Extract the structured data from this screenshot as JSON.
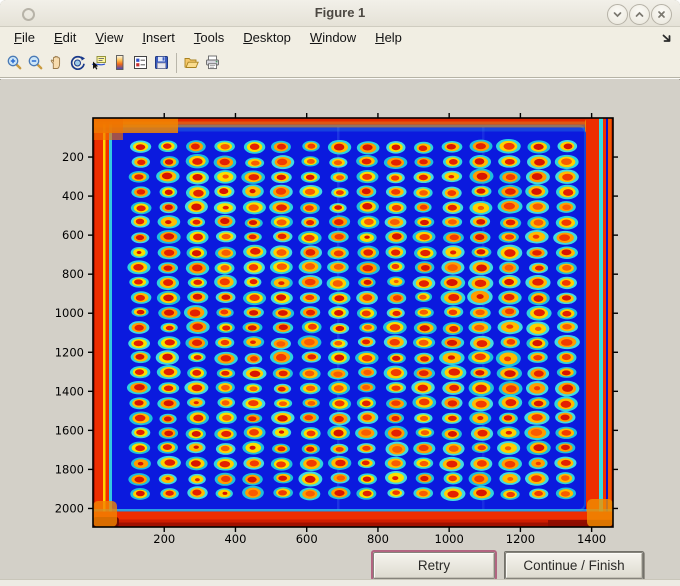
{
  "window": {
    "title": "Figure 1",
    "controls": [
      "shade-window",
      "unshade-window",
      "close-window"
    ]
  },
  "menubar": {
    "items": [
      {
        "label": "File",
        "mnemonic": "F",
        "rest": "ile"
      },
      {
        "label": "Edit",
        "mnemonic": "E",
        "rest": "dit"
      },
      {
        "label": "View",
        "mnemonic": "V",
        "rest": "iew"
      },
      {
        "label": "Insert",
        "mnemonic": "I",
        "rest": "nsert"
      },
      {
        "label": "Tools",
        "mnemonic": "T",
        "rest": "ools"
      },
      {
        "label": "Desktop",
        "mnemonic": "D",
        "rest": "esktop"
      },
      {
        "label": "Window",
        "mnemonic": "W",
        "rest": "indow"
      },
      {
        "label": "Help",
        "mnemonic": "H",
        "rest": "elp"
      }
    ]
  },
  "toolbar": {
    "buttons": [
      "zoom-in",
      "zoom-out",
      "pan",
      "rotate-3d",
      "data-cursor",
      "insert-colorbar",
      "insert-legend",
      "save-figure",
      "open-file",
      "print-figure"
    ]
  },
  "actions": {
    "retry_label": "Retry",
    "continue_label": "Continue / Finish"
  },
  "chart_data": {
    "type": "heatmap",
    "title": "",
    "xlabel": "",
    "ylabel": "",
    "x_range": [
      0,
      1460
    ],
    "y_range": [
      0,
      2095
    ],
    "x_ticks": [
      200,
      400,
      600,
      800,
      1000,
      1200,
      1400
    ],
    "y_ticks": [
      200,
      400,
      600,
      800,
      1000,
      1200,
      1400,
      1600,
      1800,
      2000
    ],
    "y_axis_direction": "image coordinates, origin top-left, y increases downward",
    "grid_on": false,
    "legend": "none",
    "description": "Jet-colormap pseudocolor scan of a 384-spot plate: 24 rows x 16 columns of spots with red-hot centers, yellow/orange rings and cyan halos on a deep blue background; saturated red/orange bands along all four plate edges with yellow and cyan streaks and orange corner blobs",
    "grid": {
      "rows": 24,
      "cols": 16,
      "first_col_center_x": 132,
      "col_pitch_x": 79.8,
      "first_row_center_y": 148,
      "row_pitch_y": 77.2
    },
    "colors": {
      "background_blue": "#0912d2",
      "plate_blue": "#0b1ade",
      "edge_red": "#ee2e00",
      "edge_dark_red": "#b81800",
      "edge_orange": "#f28500",
      "edge_yellow_streak": "#ffd400",
      "edge_cyan_streak": "#38dce2",
      "spot_centers": [
        "#d81400",
        "#e42000",
        "#f23a00",
        "#f95c00"
      ],
      "spot_rings": [
        "#f9e000",
        "#ffd000",
        "#ffbc00",
        "#ff9e00"
      ],
      "spot_halos": [
        "#2fdede",
        "#45e6e2",
        "#1fc8dc"
      ]
    },
    "seed": 20
  }
}
